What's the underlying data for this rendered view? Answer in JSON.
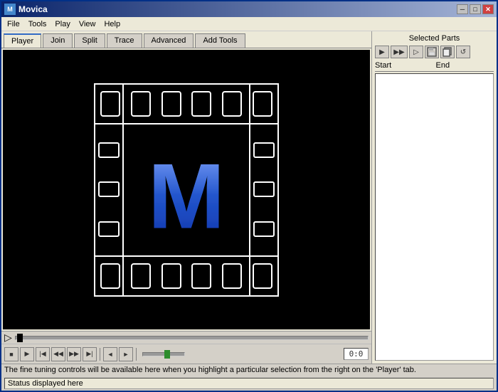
{
  "window": {
    "title": "Movica",
    "icon": "M"
  },
  "titlebar_buttons": {
    "minimize": "─",
    "maximize": "□",
    "close": "✕"
  },
  "menu": {
    "items": [
      "File",
      "Tools",
      "Play",
      "View",
      "Help"
    ]
  },
  "tabs": {
    "items": [
      "Player",
      "Join",
      "Split",
      "Trace",
      "Advanced",
      "Add Tools"
    ],
    "active": 0
  },
  "right_panel": {
    "title": "Selected Parts",
    "toolbar_btns": [
      "▶",
      "▶▶",
      "▶▷",
      "🖫",
      "📋",
      "↺"
    ],
    "col_start": "Start",
    "col_end": "End"
  },
  "controls": {
    "stop": "■",
    "play": "▶",
    "rew_start": "⏮",
    "rew": "◀◀",
    "fwd": "▶▶",
    "fwd_end": "⏭",
    "mark_in": "◄",
    "mark_out": "►",
    "time": "0:0"
  },
  "status": {
    "message": "The fine tuning controls will be available here when you highlight a particular selection from the right on the 'Player' tab.",
    "bottom": "Status displayed here"
  }
}
